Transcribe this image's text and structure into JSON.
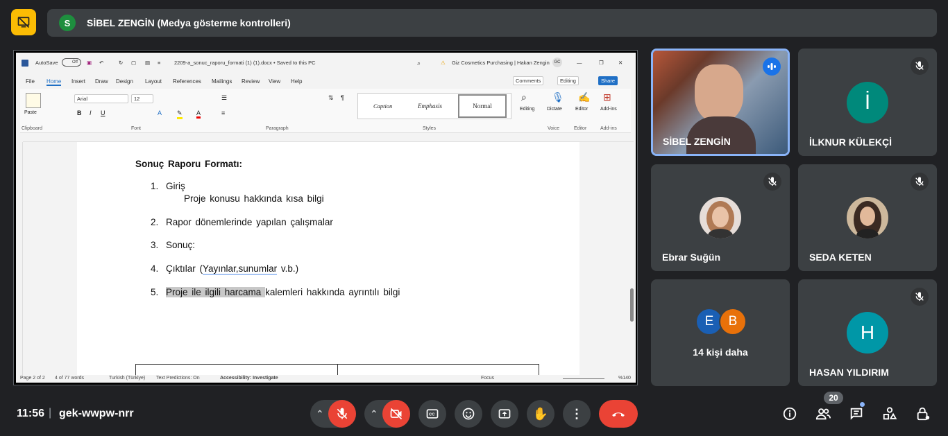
{
  "presenter": {
    "avatar_letter": "S",
    "label": "SİBEL ZENGİN (Medya gösterme kontrolleri)"
  },
  "word": {
    "autosave": "AutoSave",
    "autosave_state": "Off",
    "filename": "2209-a_sonuc_raporu_formati (1) (1).docx • Saved to this PC",
    "account": "Giz Cosmetics Purchasing | Hakan Zengin",
    "account_initials": "GC",
    "tabs": [
      "File",
      "Home",
      "Insert",
      "Draw",
      "Design",
      "Layout",
      "References",
      "Mailings",
      "Review",
      "View",
      "Help"
    ],
    "comments": "Comments",
    "editing": "Editing",
    "share": "Share",
    "font": "Arial",
    "font_size": "12",
    "styles": [
      "Caption",
      "Emphasis",
      "Normal"
    ],
    "groups": [
      "Clipboard",
      "Font",
      "Paragraph",
      "Styles",
      "Voice",
      "Editor",
      "Add-ins"
    ],
    "paste": "Paste",
    "editing_btn": "Editing",
    "dictate": "Dictate",
    "editor": "Editor",
    "addins": "Add-ins",
    "status": {
      "page": "Page 2 of 2",
      "words": "4 of 77 words",
      "language": "Turkish (Türkiye)",
      "predictions": "Text Predictions: On",
      "accessibility": "Accessibility: Investigate",
      "focus": "Focus",
      "zoom": "%140"
    },
    "doc": {
      "heading": "Sonuç Raporu Formatı:",
      "items": [
        {
          "num": "1.",
          "text": "Giriş",
          "sub": "Proje konusu hakkında kısa bilgi"
        },
        {
          "num": "2.",
          "text": "Rapor dönemlerinde yapılan çalışmalar"
        },
        {
          "num": "3.",
          "text": "Sonuç:"
        },
        {
          "num": "4.",
          "text_a": "Çıktılar (",
          "text_b": "Yayınlar,sunumlar",
          "text_c": " v.b.)"
        },
        {
          "num": "5.",
          "text_hl": "Proje ile ilgili harcama ",
          "text_rest": "kalemleri hakkında ayrıntılı bilgi"
        }
      ]
    }
  },
  "participants": [
    {
      "name": "SİBEL ZENGİN"
    },
    {
      "name": "İLKNUR KÜLEKÇİ",
      "letter": "İ",
      "color": "#00897b"
    },
    {
      "name": "Ebrar Suğün"
    },
    {
      "name": "SEDA KETEN"
    },
    {
      "name": "14 kişi daha",
      "letters": [
        "E",
        "B"
      ],
      "colors": [
        "#1a5fb4",
        "#e8710a"
      ]
    },
    {
      "name": "HASAN YILDIRIM",
      "letter": "H",
      "color": "#0097a7"
    }
  ],
  "bottom": {
    "time": "11:56",
    "separator": "|",
    "meeting_code": "gek-wwpw-nrr",
    "people_count": "20"
  },
  "icons": [
    "presenting-off-icon",
    "mic-off-icon",
    "camera-off-icon",
    "captions-icon",
    "emoji-icon",
    "present-icon",
    "raise-hand-icon",
    "more-icon",
    "end-call-icon",
    "info-icon",
    "people-icon",
    "chat-icon",
    "activities-icon",
    "host-controls-icon",
    "speaking-icon"
  ]
}
